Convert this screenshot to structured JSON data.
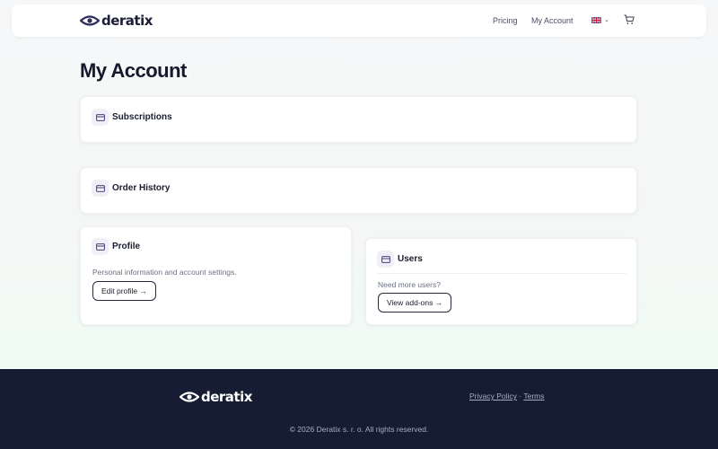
{
  "brand": {
    "name": "deratix"
  },
  "nav": {
    "links": [
      {
        "label": "Pricing"
      },
      {
        "label": "My Account"
      }
    ],
    "language_icon": "uk-flag-icon",
    "cart_icon": "cart-icon"
  },
  "page": {
    "title": "My Account"
  },
  "cards": {
    "subscriptions": {
      "title": "Subscriptions",
      "icon": "card-icon"
    },
    "order_history": {
      "title": "Order History",
      "icon": "card-icon"
    },
    "profile": {
      "title": "Profile",
      "icon": "card-icon",
      "description": "Personal information and account settings.",
      "button": "Edit profile →"
    },
    "users": {
      "title": "Users",
      "icon": "card-icon",
      "description": "Need more users?",
      "button": "View add-ons →"
    }
  },
  "footer": {
    "privacy": "Privacy Policy",
    "separator": "·",
    "terms": "Terms",
    "copyright": "© 2026 Deratix s. r. o. All rights reserved."
  },
  "colors": {
    "accent": "#2f2d5e",
    "footer_bg": "#151c33",
    "card_icon_bg": "#f0eff8"
  }
}
